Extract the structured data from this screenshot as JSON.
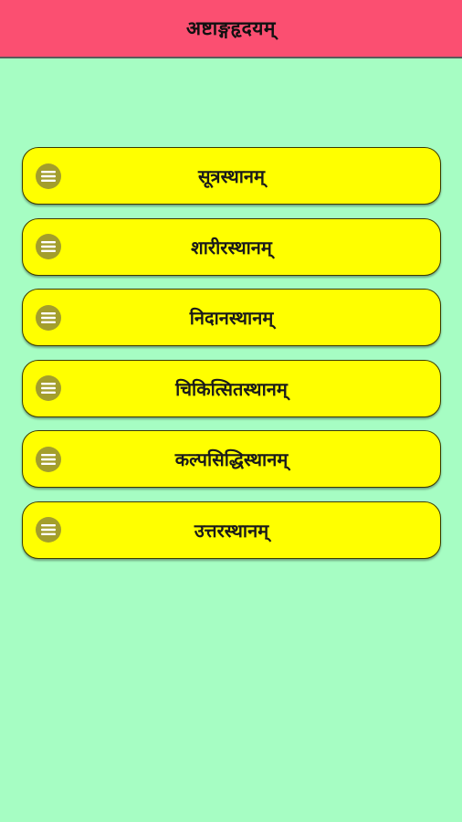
{
  "app_bar": {
    "title": "अष्टाङ्गहृदयम्"
  },
  "menu": {
    "items": [
      {
        "label": "सूत्रस्थानम्",
        "icon": "menu-lines-icon"
      },
      {
        "label": "शारीरस्थानम्",
        "icon": "menu-lines-icon"
      },
      {
        "label": "निदानस्थानम्",
        "icon": "menu-lines-icon"
      },
      {
        "label": "चिकित्सितस्थानम्",
        "icon": "menu-lines-icon"
      },
      {
        "label": "कल्पसिद्धिस्थानम्",
        "icon": "menu-lines-icon"
      },
      {
        "label": "उत्तरस्थानम्",
        "icon": "menu-lines-icon"
      }
    ]
  },
  "colors": {
    "background": "#a6fdc3",
    "app_bar": "#fb4f71",
    "button": "#ffff00",
    "icon_circle": "#a39e2c"
  }
}
